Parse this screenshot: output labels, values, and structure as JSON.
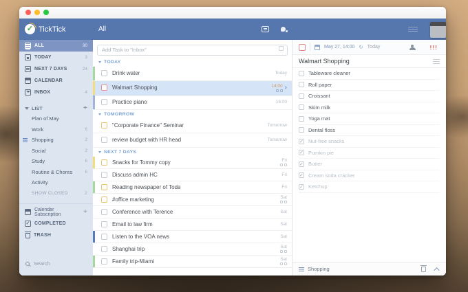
{
  "colors": {
    "header_blue": "#5677ae",
    "sidebar_bg": "#dde5f1",
    "sidebar_selected": "#7e95c4",
    "selected_row_bg": "#d5e4f7",
    "section_header_blue": "#7ba3d4",
    "priority_red": "#e25d5d",
    "bar_green": "#a6d79e",
    "bar_yellow": "#f2dd7e",
    "bar_blue": "#9fb6d8",
    "bar_navy": "#5a7cb8"
  },
  "header": {
    "logo_text": "TickTick",
    "logo_check": "✓",
    "view_title": "All"
  },
  "sidebar": {
    "smart_lists": [
      {
        "label": "ALL",
        "count": "30",
        "icon": "all",
        "selected": true
      },
      {
        "label": "TODAY",
        "count": "3",
        "icon": "today"
      },
      {
        "label": "NEXT 7 DAYS",
        "count": "24",
        "icon": "next7"
      },
      {
        "label": "CALENDAR",
        "count": "",
        "icon": "calendar"
      },
      {
        "label": "INBOX",
        "count": "4",
        "icon": "inbox"
      }
    ],
    "list_section": {
      "label": "LIST",
      "add_label": "+"
    },
    "lists": [
      {
        "label": "Plan of May",
        "count": ""
      },
      {
        "label": "Work",
        "count": "6"
      },
      {
        "label": "Shopping",
        "count": "2",
        "icon": true
      },
      {
        "label": "Social",
        "count": "2"
      },
      {
        "label": "Study",
        "count": "6"
      },
      {
        "label": "Routine & Chores",
        "count": "6"
      },
      {
        "label": "Activity",
        "count": ""
      },
      {
        "label": "SHOW CLOSED",
        "count": "2",
        "cls": "muted"
      }
    ],
    "calendar_subscription": {
      "label": "Calendar Subscription",
      "add_label": "+"
    },
    "completed_label": "COMPLETED",
    "trash_label": "TRASH",
    "search_label": "Search"
  },
  "tasklist": {
    "add_placeholder": "Add Task to \"Inbox\"",
    "sections": [
      {
        "label": "TODAY",
        "tasks": [
          {
            "title": "Drink water",
            "date": "Today",
            "bar": "green",
            "checkbox": "gray"
          },
          {
            "title": "Walmart Shopping",
            "date": "14:00",
            "bar": "yellow",
            "checkbox": "red",
            "selected": true,
            "chevron": true,
            "subicons": true
          },
          {
            "title": "Practice piano",
            "date": "16:00",
            "bar": "blue",
            "checkbox": "gray"
          }
        ]
      },
      {
        "label": "TOMORROW",
        "tasks": [
          {
            "title": "\"Corporate Finance\" Seminar",
            "date": "Tomorrow",
            "checkbox": "yellow"
          },
          {
            "title": "review budget with HR head",
            "date": "Tomorrow",
            "checkbox": "gray"
          }
        ]
      },
      {
        "label": "NEXT 7 DAYS",
        "tasks": [
          {
            "title": "Snacks for Tommy copy",
            "date": "Fri",
            "bar": "yellow",
            "checkbox": "yellow",
            "subicons": true
          },
          {
            "title": "Discuss admin HC",
            "date": "Fri",
            "checkbox": "gray"
          },
          {
            "title": "Reading newspaper of Toda",
            "date": "Fri",
            "bar": "green",
            "checkbox": "yellow"
          },
          {
            "title": "#office marketing",
            "date": "Sat",
            "checkbox": "yellow",
            "subicons": true
          },
          {
            "title": "Conference with Terence",
            "date": "Sat",
            "checkbox": "gray"
          },
          {
            "title": "Email to law firm",
            "date": "Sat",
            "checkbox": "gray"
          },
          {
            "title": "Listen to the VOA news",
            "date": "Sat",
            "bar": "navy",
            "checkbox": "gray"
          },
          {
            "title": "Shanghai trip",
            "date": "Sat",
            "checkbox": "gray",
            "subicons": true
          },
          {
            "title": "Family trip-Miami",
            "date": "Sat",
            "bar": "green",
            "checkbox": "gray",
            "subicons": true
          }
        ]
      }
    ]
  },
  "detail": {
    "toolbar": {
      "date": "May 27, 14:00",
      "repeat_glyph": "↻",
      "today_label": "Today",
      "priority": "!!!"
    },
    "title": "Walmart Shopping",
    "checklist": [
      {
        "label": "Tableware cleaner",
        "checked": false
      },
      {
        "label": "Roll paper",
        "checked": false
      },
      {
        "label": "Croissant",
        "checked": false
      },
      {
        "label": "Skim milk",
        "checked": false
      },
      {
        "label": "Yoga mat",
        "checked": false
      },
      {
        "label": "Dental floss",
        "checked": false
      },
      {
        "label": "Nut-free snacks",
        "checked": true
      },
      {
        "label": "Pumkin pie",
        "checked": true
      },
      {
        "label": "Butter",
        "checked": true
      },
      {
        "label": "Cream soda cracker",
        "checked": true
      },
      {
        "label": "Ketchup",
        "checked": true
      }
    ],
    "footer": {
      "list_label": "Shopping"
    }
  }
}
